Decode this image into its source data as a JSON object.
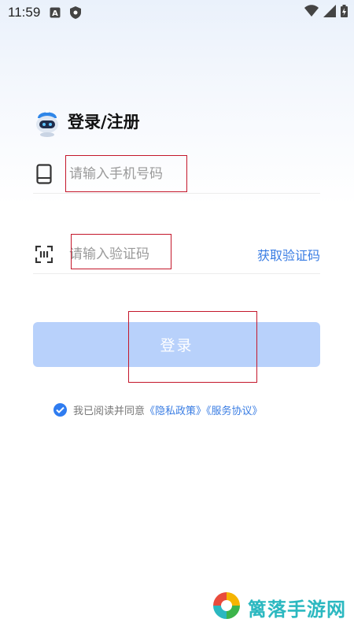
{
  "status_bar": {
    "time": "11:59"
  },
  "header": {
    "title": "登录/注册"
  },
  "phone": {
    "placeholder": "请输入手机号码"
  },
  "code": {
    "placeholder": "请输入验证码",
    "get_code_label": "获取验证码"
  },
  "login_button": {
    "label": "登录"
  },
  "agreement": {
    "prefix": "我已阅读并同意",
    "privacy_link": "《隐私政策》",
    "service_link": "《服务协议》",
    "checked": true
  },
  "watermark": {
    "text": "篱落手游网"
  },
  "colors": {
    "accent": "#3a7de3",
    "button_bg": "#b8d1fb",
    "annotation": "#c4172b"
  }
}
